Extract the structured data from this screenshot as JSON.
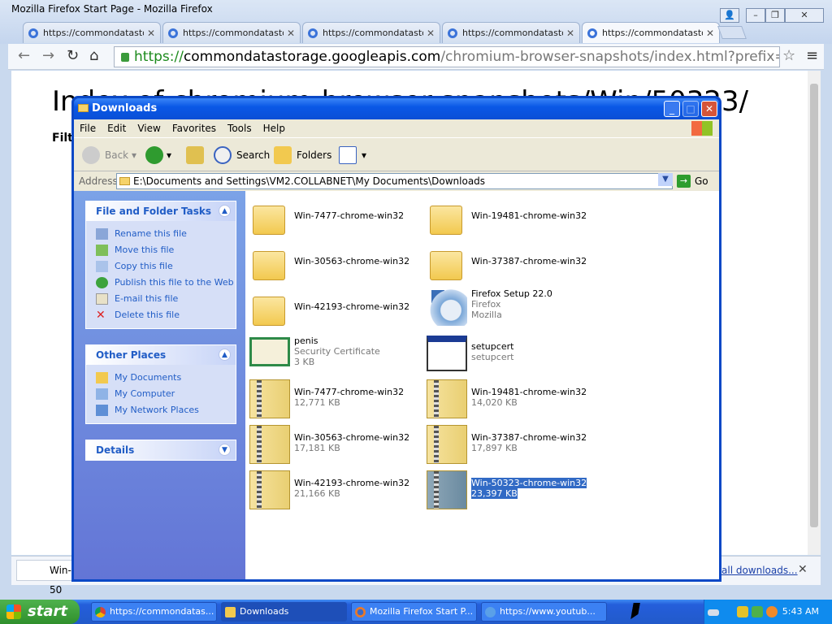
{
  "chrome": {
    "title": "Mozilla Firefox Start Page - Mozilla Firefox",
    "tabs": [
      {
        "label": "https://commondatastor"
      },
      {
        "label": "https://commondatastor"
      },
      {
        "label": "https://commondatastor"
      },
      {
        "label": "https://commondatastor"
      },
      {
        "label": "https://commondatastor"
      }
    ],
    "url_secure": "https://",
    "url_host": "commondatastorage.googleapis.com",
    "url_path": "/chromium-browser-snapshots/index.html?prefix=Win/50323/",
    "page_heading": "Index of chromium-browser-snapshots/Win/50323/",
    "filter_label": "Filte",
    "download_item": "Win-50",
    "all_downloads": "all downloads..."
  },
  "explorer": {
    "title": "Downloads",
    "menu": [
      "File",
      "Edit",
      "View",
      "Favorites",
      "Tools",
      "Help"
    ],
    "toolbar": {
      "back": "Back",
      "search": "Search",
      "folders": "Folders"
    },
    "address_label": "Address",
    "address": "E:\\Documents and Settings\\VM2.COLLABNET\\My Documents\\Downloads",
    "go": "Go",
    "file_tasks": {
      "title": "File and Folder Tasks",
      "items": [
        "Rename this file",
        "Move this file",
        "Copy this file",
        "Publish this file to the Web",
        "E-mail this file",
        "Delete this file"
      ]
    },
    "other_places": {
      "title": "Other Places",
      "items": [
        "My Documents",
        "My Computer",
        "My Network Places"
      ]
    },
    "details": {
      "title": "Details"
    },
    "files": [
      {
        "name": "Win-7477-chrome-win32",
        "type": "folder"
      },
      {
        "name": "Win-19481-chrome-win32",
        "type": "folder"
      },
      {
        "name": "Win-30563-chrome-win32",
        "type": "folder"
      },
      {
        "name": "Win-37387-chrome-win32",
        "type": "folder"
      },
      {
        "name": "Win-42193-chrome-win32",
        "type": "folder"
      },
      {
        "name": "Firefox Setup 22.0",
        "sub1": "Firefox",
        "sub2": "Mozilla",
        "type": "setup"
      },
      {
        "name": "penis",
        "sub1": "Security Certificate",
        "sub2": "3 KB",
        "type": "cert"
      },
      {
        "name": "setupcert",
        "sub1": "setupcert",
        "type": "app"
      },
      {
        "name": "Win-7477-chrome-win32",
        "sub1": "12,771 KB",
        "type": "zip"
      },
      {
        "name": "Win-19481-chrome-win32",
        "sub1": "14,020 KB",
        "type": "zip"
      },
      {
        "name": "Win-30563-chrome-win32",
        "sub1": "17,181 KB",
        "type": "zip"
      },
      {
        "name": "Win-37387-chrome-win32",
        "sub1": "17,897 KB",
        "type": "zip"
      },
      {
        "name": "Win-42193-chrome-win32",
        "sub1": "21,166 KB",
        "type": "zip"
      },
      {
        "name": "Win-50323-chrome-win32",
        "sub1": "23,397 KB",
        "type": "zip",
        "selected": true
      }
    ]
  },
  "taskbar": {
    "start": "start",
    "tasks": [
      "https://commondatas...",
      "Downloads",
      "Mozilla Firefox Start P...",
      "https://www.youtub..."
    ],
    "clock": "5:43 AM"
  }
}
